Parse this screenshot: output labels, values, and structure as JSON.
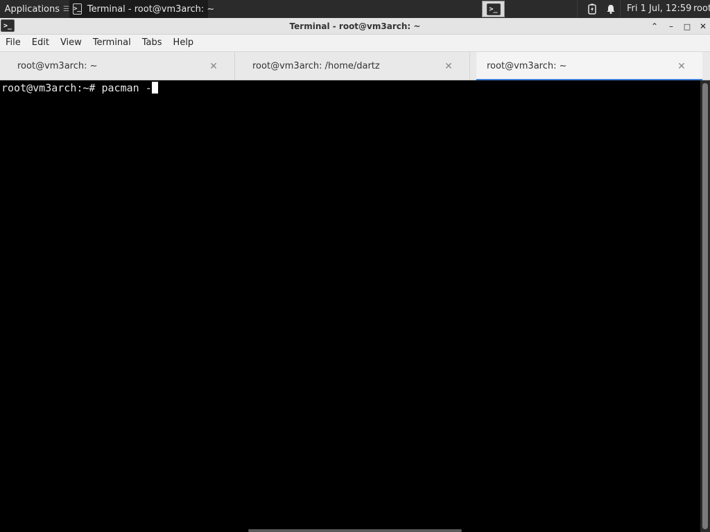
{
  "panel": {
    "applications_label": "Applications",
    "task_title": "Terminal - root@vm3arch: ~",
    "clock": "Fri 1 Jul, 12:59",
    "user": "root",
    "icons": [
      "arch-linux-icon",
      "terminal-icon",
      "battery-icon",
      "notification-bell-icon"
    ]
  },
  "window": {
    "title": "Terminal - root@vm3arch: ~",
    "minimize_glyph": "–",
    "maximize_glyph": "□",
    "close_glyph": "✕",
    "shade_glyph": "⌃"
  },
  "menu": {
    "items": [
      "File",
      "Edit",
      "View",
      "Terminal",
      "Tabs",
      "Help"
    ]
  },
  "tabs": [
    {
      "label": "root@vm3arch: ~",
      "active": false
    },
    {
      "label": "root@vm3arch: /home/dartz",
      "active": false
    },
    {
      "label": "root@vm3arch: ~",
      "active": true
    }
  ],
  "terminal": {
    "prompt": "root@vm3arch:~# ",
    "command": "pacman -"
  },
  "colors": {
    "accent": "#3c7dd8",
    "terminal_bg": "#000000",
    "terminal_fg": "#e8e8e8",
    "panel_bg": "#2b2b2b"
  }
}
